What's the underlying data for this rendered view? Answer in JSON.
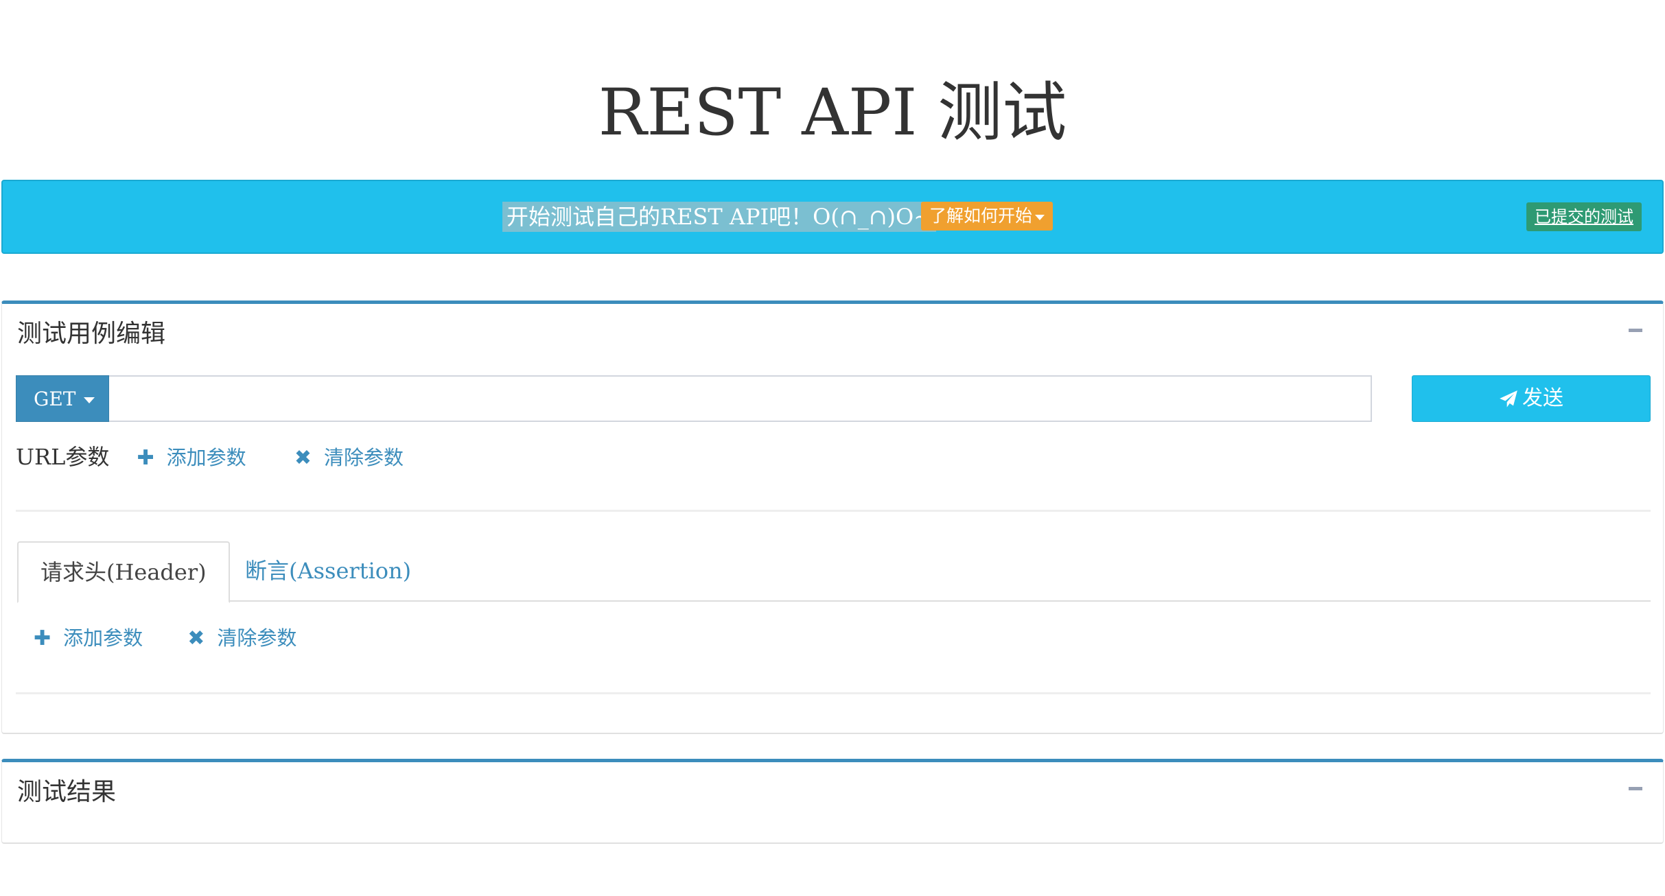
{
  "page": {
    "title": "REST API 测试"
  },
  "banner": {
    "message": "开始测试自己的REST API吧！O(∩_∩)O~",
    "howto_label": "了解如何开始",
    "submitted_label": "已提交的测试"
  },
  "editor": {
    "title": "测试用例编辑",
    "method": "GET",
    "url_value": "",
    "url_placeholder": "",
    "send_label": "发送",
    "url_params_label": "URL参数",
    "add_param_label": "添加参数",
    "clear_param_label": "清除参数",
    "tabs": [
      {
        "label": "请求头(Header)",
        "active": true
      },
      {
        "label": "断言(Assertion)",
        "active": false
      }
    ],
    "header_add_label": "添加参数",
    "header_clear_label": "清除参数"
  },
  "result": {
    "title": "测试结果"
  },
  "icons": {
    "add": "plus-icon",
    "clear": "close-icon",
    "send": "paper-plane-icon",
    "collapse": "minus-icon",
    "dropdown": "caret-down-icon"
  },
  "colors": {
    "primary": "#3c8dbc",
    "info": "#20c0ec",
    "warning": "#f0a02f",
    "success": "#2e9a73"
  }
}
